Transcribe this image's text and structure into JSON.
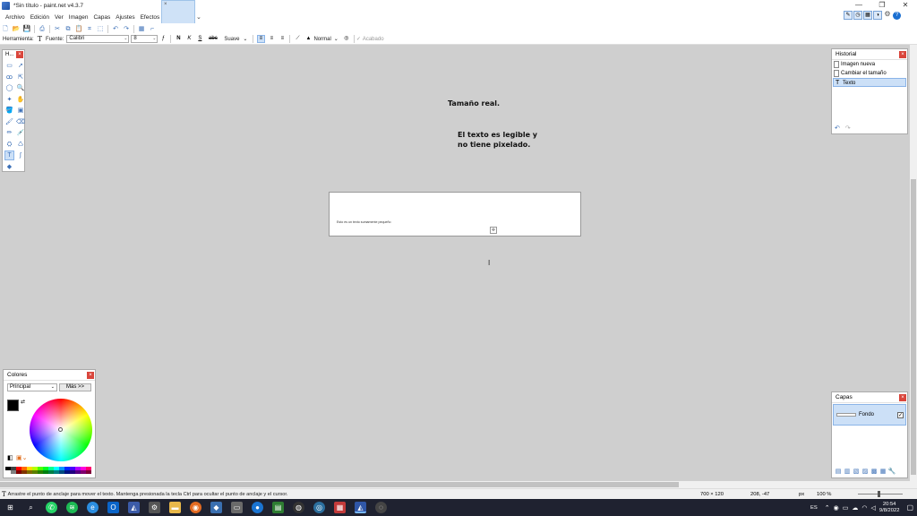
{
  "window": {
    "title": "*Sin título - paint.net v4.3.7",
    "min": "—",
    "restore": "❐",
    "close": "✕"
  },
  "menu": [
    "Archivo",
    "Edición",
    "Ver",
    "Imagen",
    "Capas",
    "Ajustes",
    "Efectos"
  ],
  "thumb_close": "×",
  "thumb_arrow": "⌄",
  "toolbar2": {
    "herramienta_label": "Herramienta:",
    "tool_glyph": "T",
    "fuente_label": "Fuente:",
    "font": "Calibri",
    "size": "8",
    "bold": "N",
    "italic": "K",
    "underline": "S",
    "strike": "abc",
    "antialias": "Suave",
    "blend": "Normal",
    "finish": "Acabado"
  },
  "canvas": {
    "text_real": "Tamaño real.",
    "text_legible": "El texto es legible y no tiene pixelado.",
    "small_text": "Esto es un texto sumamente pequeño",
    "cursor": "I"
  },
  "tools_panel": {
    "title": "H...",
    "close": "×"
  },
  "historial": {
    "title": "Historial",
    "close": "×",
    "items": [
      "Imagen nueva",
      "Cambiar el tamaño",
      "Texto"
    ],
    "undo": "↶",
    "redo": "↷"
  },
  "colores": {
    "title": "Colores",
    "close": "×",
    "mode": "Principal",
    "more": "Más >>",
    "primary_color": "#000000",
    "secondary_color": "#ffffff"
  },
  "capas": {
    "title": "Capas",
    "close": "×",
    "layer_name": "Fondo",
    "check": "✓"
  },
  "status": {
    "message": "Arrastre el punto de anclaje para mover el texto. Mantenga presionada la tecla Ctrl para ocultar el punto de anclaje y el cursor.",
    "image_size": "700 × 120",
    "coords": "208, -47",
    "unit": "px",
    "zoom": "100 %"
  },
  "taskbar": {
    "lang": "ES",
    "time": "20:54",
    "date": "9/8/2022"
  },
  "palette": [
    "#000000",
    "#404040",
    "#ff0000",
    "#ff6a00",
    "#ffd800",
    "#b6ff00",
    "#4cff00",
    "#00ff21",
    "#00ff90",
    "#00ffff",
    "#0094ff",
    "#0026ff",
    "#4800ff",
    "#b200ff",
    "#ff00dc",
    "#ff006e",
    "#ffffff",
    "#808080",
    "#7f0000",
    "#7f3300",
    "#7f6a00",
    "#5b7f00",
    "#267f00",
    "#007f0e",
    "#007f46",
    "#007f7f",
    "#004a7f",
    "#00137f",
    "#21007f",
    "#57007f",
    "#7f006e",
    "#7f0037"
  ]
}
